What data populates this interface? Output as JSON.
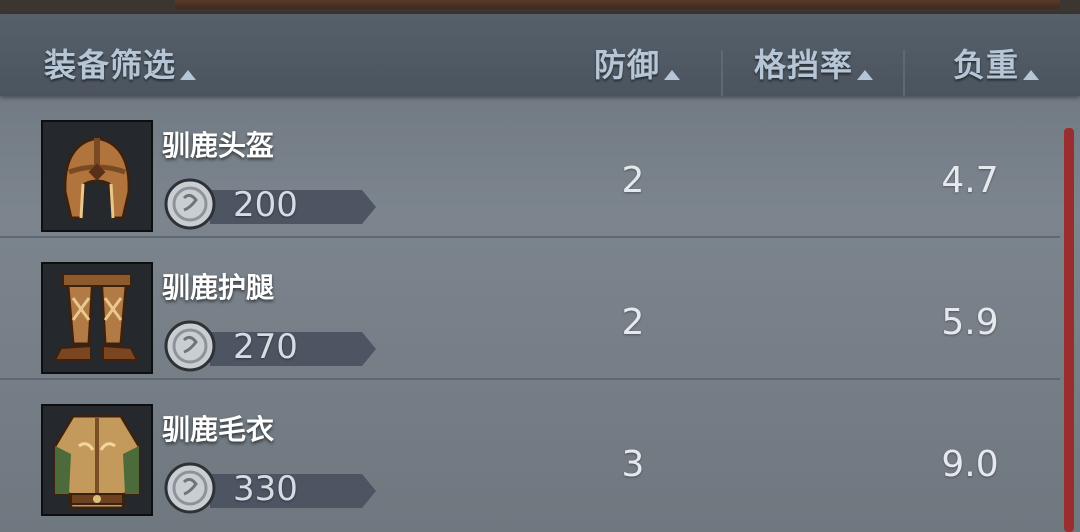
{
  "header": {
    "filter_label": "装备筛选",
    "defense_label": "防御",
    "block_rate_label": "格挡率",
    "weight_label": "负重"
  },
  "items": [
    {
      "name": "驯鹿头盔",
      "price": "200",
      "defense": "2",
      "weight": "4.7",
      "icon": "helmet-icon"
    },
    {
      "name": "驯鹿护腿",
      "price": "270",
      "defense": "2",
      "weight": "5.9",
      "icon": "leggings-icon"
    },
    {
      "name": "驯鹿毛衣",
      "price": "330",
      "defense": "3",
      "weight": "9.0",
      "icon": "sweater-icon"
    }
  ],
  "colors": {
    "header_text": "#b7c6d6",
    "accent_scrollbar": "#9a2d2d"
  }
}
